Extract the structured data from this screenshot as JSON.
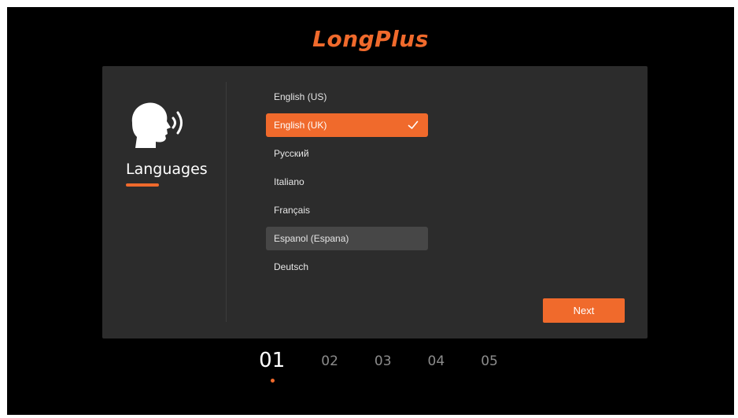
{
  "brand": {
    "name": "LongPlus"
  },
  "sidebar": {
    "title": "Languages",
    "icon": "speaking-head-icon"
  },
  "languages": {
    "items": [
      {
        "label": "English (US)"
      },
      {
        "label": "English (UK)"
      },
      {
        "label": "Русский"
      },
      {
        "label": "Italiano"
      },
      {
        "label": "Français"
      },
      {
        "label": "Espanol (Espana)"
      },
      {
        "label": "Deutsch"
      }
    ],
    "selected_index": 1,
    "focused_index": 5
  },
  "actions": {
    "next_label": "Next"
  },
  "steps": {
    "items": [
      "01",
      "02",
      "03",
      "04",
      "05"
    ],
    "current_index": 0
  },
  "colors": {
    "accent": "#f06a2c",
    "background": "#000000",
    "panel": "#2c2c2c",
    "focus": "#474747",
    "step_inactive": "#8c8c8c"
  }
}
